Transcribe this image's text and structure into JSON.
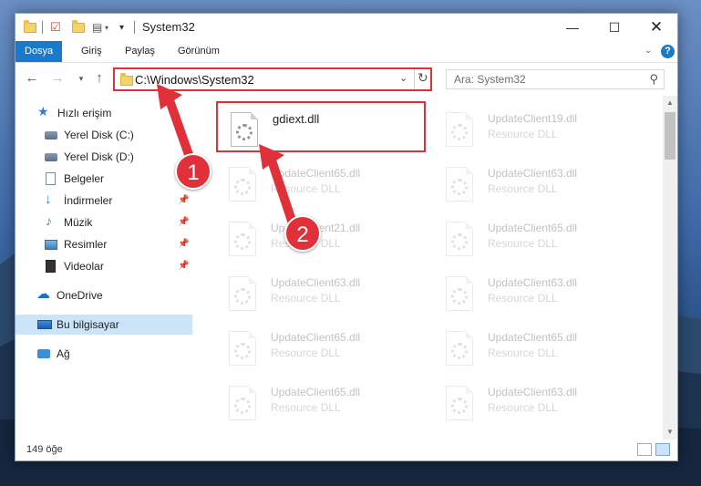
{
  "window": {
    "title": "System32",
    "quick_access_dropdown": "▾"
  },
  "ribbon": {
    "tabs": [
      {
        "label": "Dosya",
        "active": true
      },
      {
        "label": "Giriş",
        "active": false
      },
      {
        "label": "Paylaş",
        "active": false
      },
      {
        "label": "Görünüm",
        "active": false
      }
    ],
    "help": "?"
  },
  "address_bar": {
    "path": "C:\\Windows\\System32",
    "search_placeholder": "Ara: System32"
  },
  "sidebar": {
    "items": [
      {
        "label": "Hızlı erişim",
        "icon": "star-icon"
      },
      {
        "label": "Yerel Disk (C:)",
        "icon": "drive-icon"
      },
      {
        "label": "Yerel Disk (D:)",
        "icon": "drive-icon"
      },
      {
        "label": "Belgeler",
        "icon": "document-icon"
      },
      {
        "label": "İndirmeler",
        "icon": "download-icon"
      },
      {
        "label": "Müzik",
        "icon": "music-icon"
      },
      {
        "label": "Resimler",
        "icon": "pictures-icon"
      },
      {
        "label": "Videolar",
        "icon": "video-icon"
      },
      {
        "label": "OneDrive",
        "icon": "cloud-icon"
      },
      {
        "label": "Bu bilgisayar",
        "icon": "computer-icon",
        "selected": true
      },
      {
        "label": "Ağ",
        "icon": "network-icon"
      }
    ]
  },
  "files": [
    {
      "name": "gdiext.dll",
      "type": "",
      "highlighted": true
    },
    {
      "name": "UpdateClient19.dll",
      "type": "Resource DLL"
    },
    {
      "name": "UpdateClient65.dll",
      "type": "Resource DLL"
    },
    {
      "name": "UpdateClient63.dll",
      "type": "Resource DLL"
    },
    {
      "name": "UpdateClient21.dll",
      "type": "Resource DLL"
    },
    {
      "name": "UpdateClient65.dll",
      "type": "Resource DLL"
    },
    {
      "name": "UpdateClient63.dll",
      "type": "Resource DLL"
    },
    {
      "name": "UpdateClient63.dll",
      "type": "Resource DLL"
    },
    {
      "name": "UpdateClient65.dll",
      "type": "Resource DLL"
    },
    {
      "name": "UpdateClient65.dll",
      "type": "Resource DLL"
    },
    {
      "name": "UpdateClient65.dll",
      "type": "Resource DLL"
    },
    {
      "name": "UpdateClient63.dll",
      "type": "Resource DLL"
    }
  ],
  "status": {
    "item_count": "149 öğe"
  },
  "annotations": {
    "step1": "1",
    "step2": "2",
    "color": "#e0313a"
  }
}
